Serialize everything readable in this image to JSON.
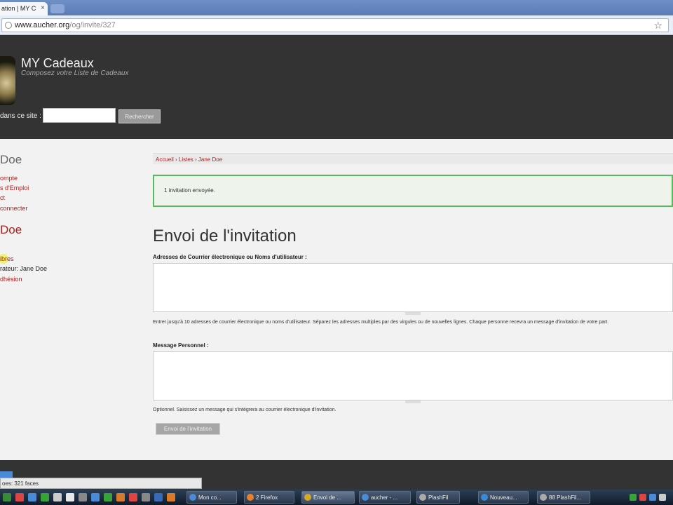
{
  "browser": {
    "tab_title": "ation | MY C",
    "tab_close": "×",
    "url_host": "www.aucher.org",
    "url_path": "/og/invite/327",
    "star": "☆"
  },
  "site": {
    "name": "MY Cadeaux",
    "slogan": "Composez votre Liste de Cadeaux",
    "search_label": "dans ce site :",
    "search_value": "",
    "search_button": "Rechercher"
  },
  "sidebar": {
    "user_title": "Doe",
    "user_links": [
      "ompte",
      "s d'Emploi",
      "ct",
      "connecter"
    ],
    "group_title": "Doe",
    "group_link": "ibres",
    "group_admin": "rateur: Jane Doe",
    "group_join": "dhésion"
  },
  "main": {
    "breadcrumb": "Accueil › Listes › Jane Doe",
    "status_message": "1 invitation envoyée.",
    "page_title": "Envoi de l'invitation",
    "emails_label": "Adresses de Courrier électronique ou Noms d'utilisateur :",
    "emails_value": "",
    "emails_help": "Entrer jusqu'à 10 adresses de courrier électronique ou noms d'utilisateur. Séparez les adresses multiples par des virgules ou de nouvelles lignes. Chaque personne recevra un message d'invitation de votre part.",
    "message_label": "Message Personnel :",
    "message_value": "",
    "message_help": "Optionnel. Saisissez un message qui s'intégrera au courrier électronique d'invitation.",
    "submit_label": "Envoi de l'invitation"
  },
  "status_bar": "oes: 321 faces",
  "taskbar": {
    "buttons": [
      "Mon co...",
      "2 Firefox",
      "Envoi de ...",
      "aucher - ...",
      "PlashFil",
      "Nouveau...",
      "88 PlashFil..."
    ]
  },
  "colors": {
    "header_bg": "#333333",
    "link_red": "#b02020",
    "success_green": "#5cb85c"
  }
}
